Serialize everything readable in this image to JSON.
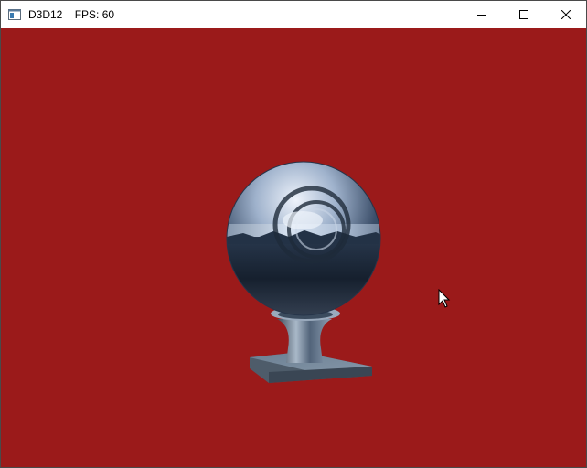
{
  "window": {
    "title": "D3D12    FPS: 60"
  },
  "viewport": {
    "clear_color": "#9b1a1a",
    "scene_object": "chrome-sphere-material-preview"
  },
  "icons": {
    "app": "window-app-icon",
    "minimize": "minimize-icon",
    "maximize": "maximize-icon",
    "close": "close-icon",
    "cursor": "mouse-cursor-icon"
  }
}
